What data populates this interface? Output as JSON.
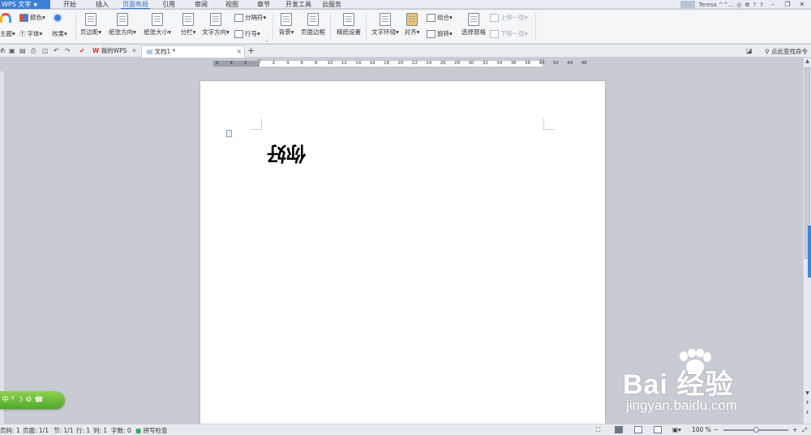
{
  "app": {
    "logo_label": "WPS 文字",
    "user_name": "Teresa ^^...",
    "menu_tabs": [
      "开始",
      "插入",
      "页面布局",
      "引用",
      "审阅",
      "视图",
      "章节",
      "开发工具",
      "云服务"
    ],
    "active_tab_index": 2,
    "accent_color": "#2f6fc6"
  },
  "ribbon": {
    "theme_label": "主题",
    "color_label": "颜色",
    "font_label": "字体",
    "effect_label": "效果",
    "margins_label": "页边距",
    "orientation_label": "纸张方向",
    "size_label": "纸张大小",
    "columns_label": "分栏",
    "text_direction_label": "文字方向",
    "breaks_label": "分隔符",
    "line_numbers_label": "行号",
    "background_label": "背景",
    "page_border_label": "页面边框",
    "manuscript_label": "稿纸设置",
    "wrap_text_label": "文字环绕",
    "align_label": "对齐",
    "group_label": "组合",
    "rotate_label": "旋转",
    "selection_pane_label": "选择窗格",
    "bring_forward_label": "上移一层",
    "send_backward_label": "下移一层"
  },
  "tabs": {
    "home_tab": "我的WPS",
    "doc_tab": "文档1 *",
    "add_tab": "+",
    "search_cmd": "点此查找命令"
  },
  "ruler": {
    "ticks_left": [
      "6",
      "4",
      "2"
    ],
    "ticks_right": [
      "2",
      "4",
      "6",
      "8",
      "10",
      "12",
      "14",
      "16",
      "18",
      "20",
      "22",
      "24",
      "26",
      "28",
      "30",
      "32",
      "34",
      "36",
      "38",
      "40",
      "42",
      "44",
      "46"
    ]
  },
  "document": {
    "text": "你好",
    "text_rotation_deg": 180
  },
  "ime": {
    "label": "中 ⁹ ☽ ⚙ ☎"
  },
  "watermark": {
    "main": "Bai  经验",
    "sub": "jingyan.baidu.com"
  },
  "status": {
    "page_num": "页码: 1",
    "pages": "页面: 1/1",
    "section": "节: 1/1",
    "row": "行: 1",
    "col": "列: 1",
    "word_count": "字数: 0",
    "spell_check": "拼写检查",
    "zoom": "100 %",
    "zoom_level": 0.5
  }
}
